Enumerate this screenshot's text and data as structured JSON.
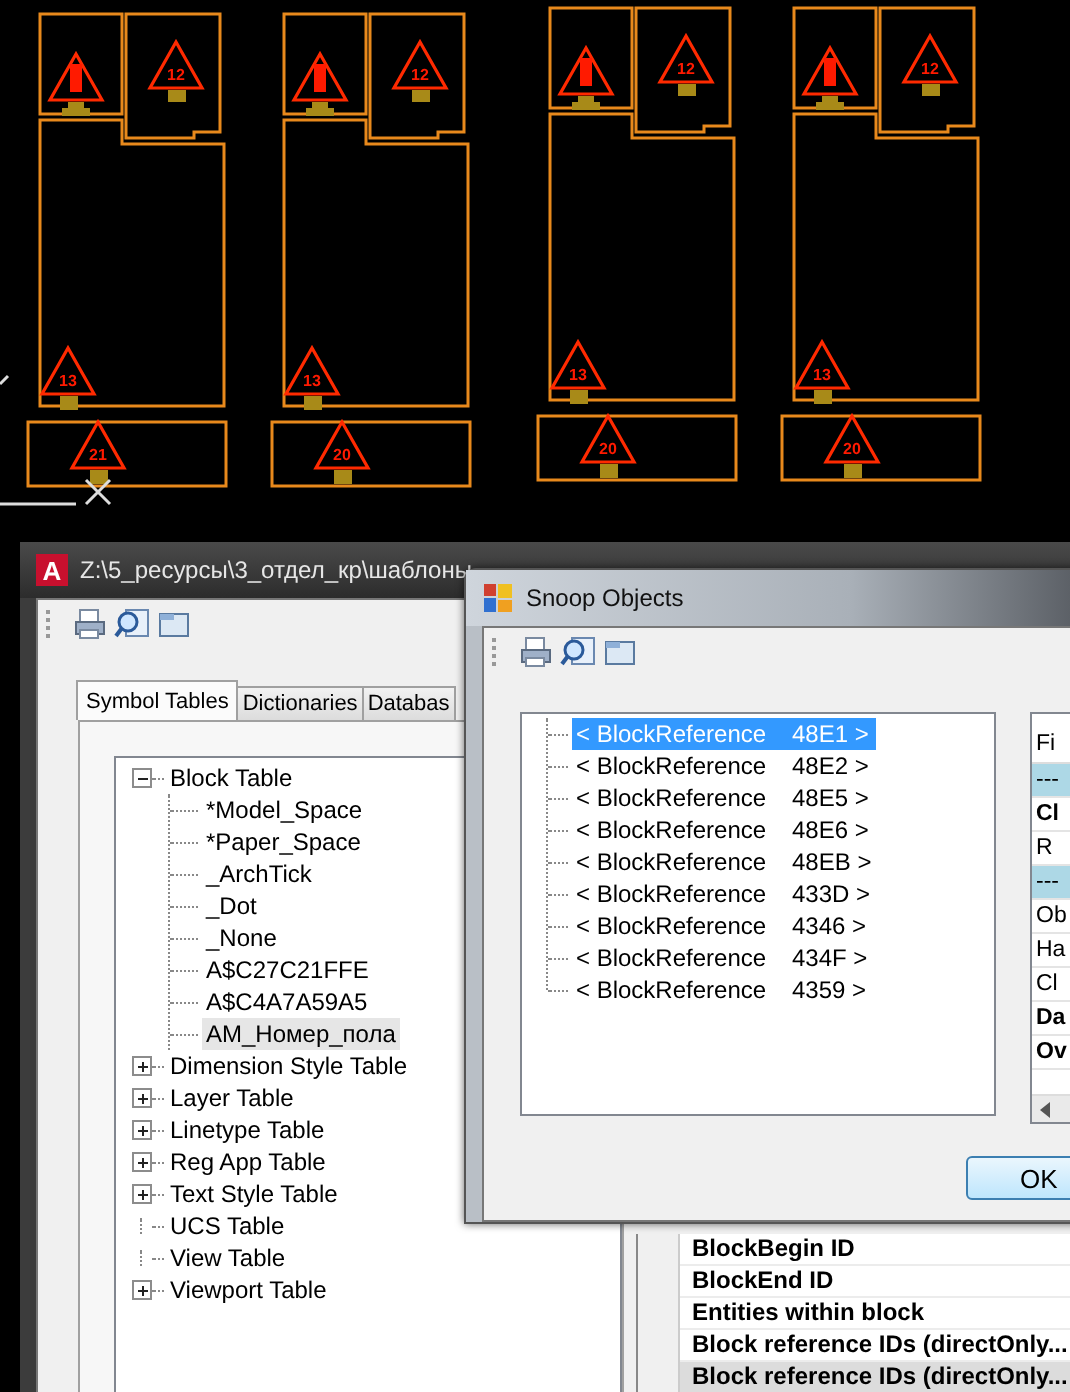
{
  "cad_drawing": {
    "plans": [
      {
        "tags": [
          "12",
          "13",
          "21"
        ]
      },
      {
        "tags": [
          "12",
          "13",
          "20"
        ]
      },
      {
        "tags": [
          "12",
          "13",
          "20"
        ]
      },
      {
        "tags": [
          "12",
          "13",
          "20"
        ]
      }
    ]
  },
  "main_window": {
    "app_logo": "A",
    "title": "Z:\\5_ресурсы\\3_отдел_кр\\шаблоны",
    "tabs": [
      {
        "label": "Symbol Tables",
        "selected": true
      },
      {
        "label": "Dictionaries",
        "selected": false
      },
      {
        "label": "Databas",
        "selected": false
      }
    ],
    "tree": [
      {
        "label": "Block Table",
        "kind": "branch",
        "expanded": true,
        "children": [
          {
            "label": "*Model_Space",
            "selected": false
          },
          {
            "label": "*Paper_Space",
            "selected": false
          },
          {
            "label": "_ArchTick",
            "selected": false
          },
          {
            "label": "_Dot",
            "selected": false
          },
          {
            "label": "_None",
            "selected": false
          },
          {
            "label": "A$C27C21FFE",
            "selected": false
          },
          {
            "label": "A$C4A7A59A5",
            "selected": false
          },
          {
            "label": "AM_Номер_пола",
            "selected": true
          }
        ]
      },
      {
        "label": "Dimension Style Table",
        "kind": "branch",
        "expanded": false
      },
      {
        "label": "Layer Table",
        "kind": "branch",
        "expanded": false
      },
      {
        "label": "Linetype Table",
        "kind": "branch",
        "expanded": false
      },
      {
        "label": "Reg App Table",
        "kind": "branch",
        "expanded": false
      },
      {
        "label": "Text Style Table",
        "kind": "branch",
        "expanded": false
      },
      {
        "label": "UCS Table",
        "kind": "leaf"
      },
      {
        "label": "View Table",
        "kind": "leaf"
      },
      {
        "label": "Viewport Table",
        "kind": "branch",
        "expanded": false
      }
    ],
    "properties": [
      {
        "field": "BlockBegin ID",
        "selected": false
      },
      {
        "field": "BlockEnd ID",
        "selected": false
      },
      {
        "field": "Entities within block",
        "selected": false
      },
      {
        "field": "Block reference IDs (directOnly...",
        "selected": false
      },
      {
        "field": "Block reference IDs (directOnly...",
        "selected": true
      }
    ]
  },
  "snoop_window": {
    "title": "Snoop Objects",
    "objects": [
      {
        "type": "< BlockReference",
        "handle": "48E1 >",
        "selected": true
      },
      {
        "type": "< BlockReference",
        "handle": "48E2 >",
        "selected": false
      },
      {
        "type": "< BlockReference",
        "handle": "48E5 >",
        "selected": false
      },
      {
        "type": "< BlockReference",
        "handle": "48E6 >",
        "selected": false
      },
      {
        "type": "< BlockReference",
        "handle": "48EB >",
        "selected": false
      },
      {
        "type": "< BlockReference",
        "handle": "433D >",
        "selected": false
      },
      {
        "type": "< BlockReference",
        "handle": "4346 >",
        "selected": false
      },
      {
        "type": "< BlockReference",
        "handle": "434F >",
        "selected": false
      },
      {
        "type": "< BlockReference",
        "handle": "4359 >",
        "selected": false
      }
    ],
    "field_header": "Fi",
    "fields": [
      {
        "text": "---",
        "kind": "category"
      },
      {
        "text": "Cl",
        "kind": "bold"
      },
      {
        "text": "R",
        "kind": "normal"
      },
      {
        "text": "---",
        "kind": "category"
      },
      {
        "text": "Ob",
        "kind": "normal"
      },
      {
        "text": "Ha",
        "kind": "normal"
      },
      {
        "text": "Cl",
        "kind": "normal"
      },
      {
        "text": "Da",
        "kind": "bold"
      },
      {
        "text": "Ov",
        "kind": "bold"
      }
    ],
    "ok_button": "OK"
  }
}
